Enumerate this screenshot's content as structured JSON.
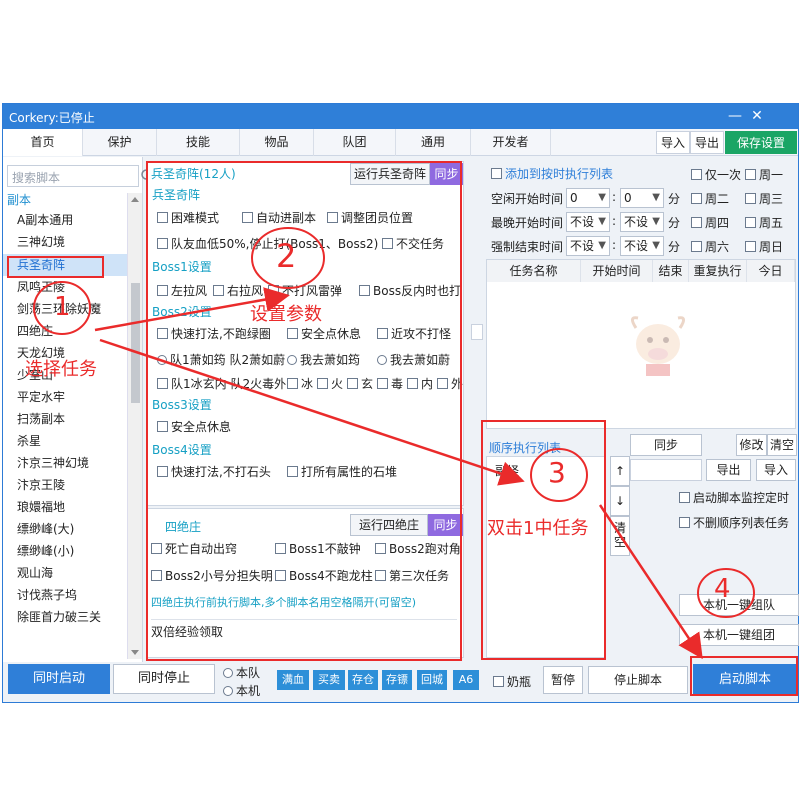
{
  "window": {
    "title": "Corkery:已停止",
    "min_icon": "minimize-icon",
    "close_icon": "close-icon"
  },
  "tabs": [
    "首页",
    "保护",
    "技能",
    "物品",
    "队团",
    "通用",
    "开发者"
  ],
  "top_buttons": {
    "import": "导入",
    "export": "导出",
    "save": "保存设置"
  },
  "sidebar": {
    "search_placeholder": "搜索脚本",
    "category": "副本",
    "items": [
      "A副本通用",
      "三神幻境",
      "兵圣奇阵",
      "凤鸣王陵",
      "剑荡三环除妖魔",
      "四绝庄",
      "天龙幻境",
      "少室山",
      "平定水牢",
      "扫荡副本",
      "杀星",
      "汴京三神幻境",
      "汴京王陵",
      "琅嬛福地",
      "缥缈峰(大)",
      "缥缈峰(小)",
      "观山海",
      "讨伐燕子坞",
      "除匪首力破三关"
    ]
  },
  "panel1": {
    "header": "兵圣奇阵(12人)",
    "run_btn": "运行兵圣奇阵",
    "sync_btn": "同步",
    "sec_main": "兵圣奇阵",
    "main_opts": [
      "困难模式",
      "自动进副本",
      "调整团员位置",
      "队友血低50%,停止打(Boss1、Boss2)",
      "不交任务"
    ],
    "sec_boss1": "Boss1设置",
    "boss1_opts": [
      "左拉风",
      "右拉风",
      "不打风雷弹",
      "Boss反内时也打"
    ],
    "sec_boss2": "Boss2设置",
    "boss2_opts": [
      "快速打法,不跑绿圈",
      "安全点休息",
      "近攻不打怪"
    ],
    "boss2_radios": [
      "队1萧如筠 队2萧如蔚",
      "我去萧如筠",
      "我去萧如蔚"
    ],
    "boss2_elem_lead": "队1冰玄内 队2火毒外",
    "boss2_elems": [
      "冰",
      "火",
      "玄",
      "毒",
      "内",
      "外"
    ],
    "sec_boss3": "Boss3设置",
    "boss3_opts": [
      "安全点休息"
    ],
    "sec_boss4": "Boss4设置",
    "boss4_opts": [
      "快速打法,不打石头",
      "打所有属性的石堆"
    ]
  },
  "panel2": {
    "header": "四绝庄",
    "run_btn": "运行四绝庄",
    "sync_btn": "同步",
    "opts": [
      "死亡自动出窍",
      "Boss1不敲钟",
      "Boss2跑对角",
      "Boss2小号分担失明",
      "Boss4不跑龙柱",
      "第三次任务"
    ],
    "note": "四绝庄执行前执行脚本,多个脚本名用空格隔开(可留空)",
    "list_item": "双倍经验领取"
  },
  "schedule": {
    "add_check": "添加到按时执行列表",
    "rows": [
      {
        "label": "空闲开始时间",
        "a": "0",
        "b": "0",
        "unit": "分"
      },
      {
        "label": "最晚开始时间",
        "a": "不设",
        "b": "不设",
        "unit": "分"
      },
      {
        "label": "强制结束时间",
        "a": "不设",
        "b": "不设",
        "unit": "分"
      }
    ],
    "days": [
      "仅一次",
      "周一",
      "周二",
      "周三",
      "周四",
      "周五",
      "周六",
      "周日"
    ],
    "columns": [
      "任务名称",
      "开始时间",
      "结束",
      "重复执行",
      "今日"
    ]
  },
  "sequence": {
    "title": "顺序执行列表",
    "first_item": "副怪",
    "sync": "同步",
    "modify": "修改",
    "clear": "清空",
    "export": "导出",
    "import": "导入",
    "clear_vertical": "清空",
    "opt1": "启动脚本监控定时",
    "opt2": "不删顺序列表任务",
    "btn_team": "本机一键组队",
    "btn_group": "本机一键组团",
    "up_icon": "↑",
    "down_icon": "↓"
  },
  "bottom": {
    "start_all": "同时启动",
    "stop_all": "同时停止",
    "radio_team": "本队",
    "radio_local": "本机",
    "mini": [
      "满血",
      "买卖",
      "存仓",
      "存镖",
      "回城",
      "A6"
    ],
    "milk": "奶瓶",
    "pause": "暂停",
    "stop_script": "停止脚本",
    "start_script": "启动脚本"
  },
  "annotations": {
    "n1": "1",
    "n2": "2",
    "n3": "3",
    "n4": "4",
    "t1": "选择任务",
    "t2": "设置参数",
    "t3": "双击1中任务"
  },
  "colors": {
    "accent": "#2f7fd8",
    "annotation": "#ea2b2b",
    "green": "#1aa565",
    "purple": "#8f6ae0"
  }
}
